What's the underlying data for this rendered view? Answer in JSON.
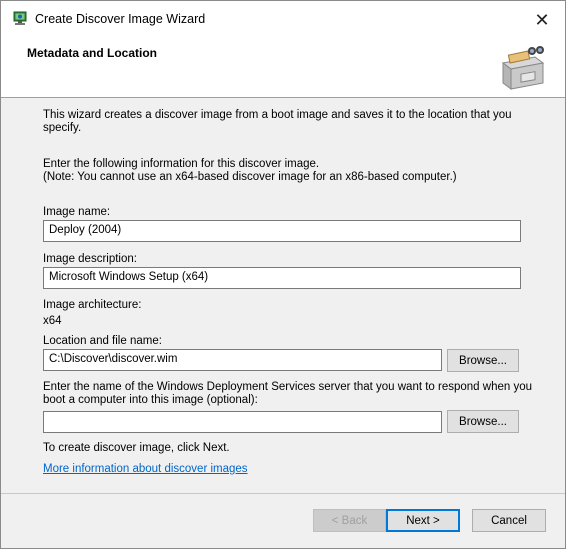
{
  "window": {
    "title": "Create Discover Image Wizard",
    "close_glyph": "✕"
  },
  "header": {
    "title": "Metadata and Location"
  },
  "intro": {
    "line1": "This wizard creates a discover image from a boot image and saves it to the location that you",
    "line2": "specify."
  },
  "instructions": {
    "line1": "Enter the following information for this discover image.",
    "line2": "(Note: You cannot use an x64-based discover image for an x86-based computer.)"
  },
  "image_name": {
    "label": "Image name:",
    "value": "Deploy (2004)"
  },
  "image_description": {
    "label": "Image description:",
    "value": "Microsoft Windows Setup (x64)"
  },
  "image_architecture": {
    "label": "Image architecture:",
    "value": "x64"
  },
  "location": {
    "label": "Location and file name:",
    "value": "C:\\Discover\\discover.wim",
    "browse_label": "Browse..."
  },
  "server": {
    "label_line1": "Enter the  name of the Windows Deployment Services server that you want to respond when you",
    "label_line2": "boot a computer into this image (optional):",
    "value": "",
    "browse_label": "Browse..."
  },
  "next_hint": "To create discover image, click Next.",
  "more_info_link": "More information about discover images",
  "footer": {
    "back_label": "< Back",
    "next_label": "Next >",
    "cancel_label": "Cancel"
  },
  "icons": {
    "title_icon": "network-computer-icon",
    "header_icon": "file-cabinet-binoculars-icon",
    "close": "close-icon"
  }
}
